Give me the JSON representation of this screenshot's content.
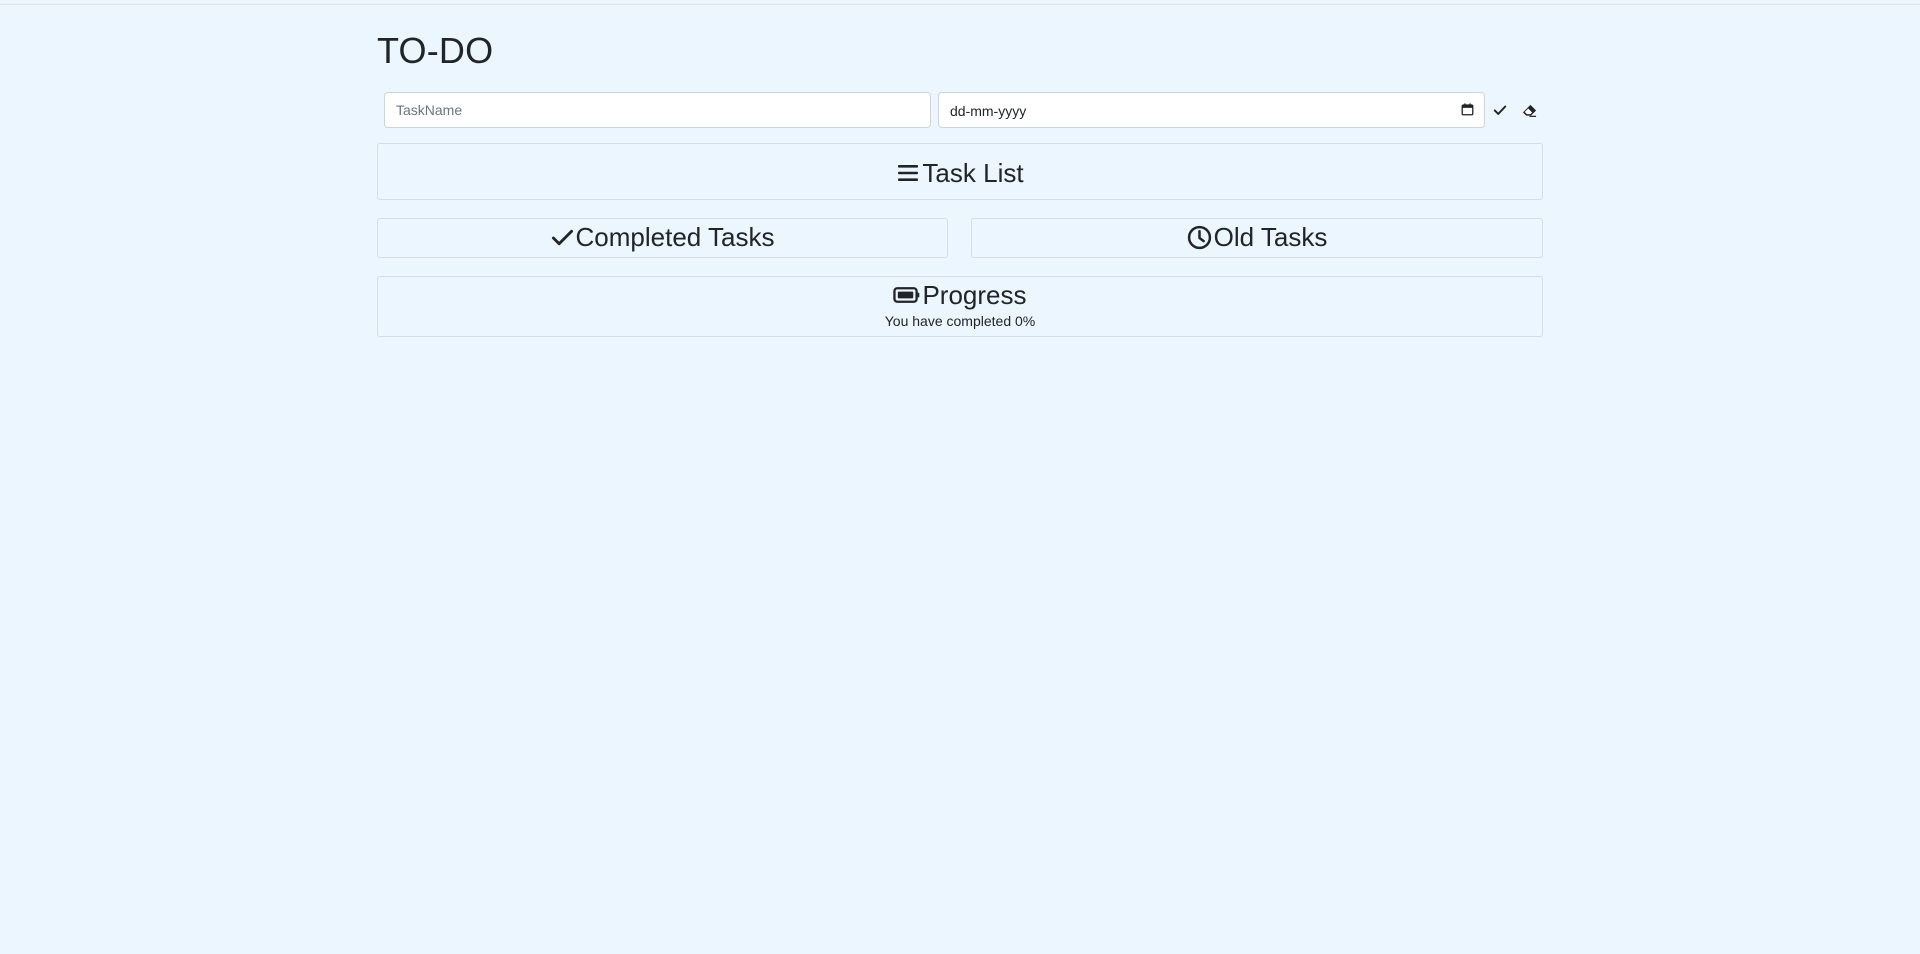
{
  "app": {
    "title": "TO-DO"
  },
  "form": {
    "task_name_placeholder": "TaskName",
    "task_name_value": "",
    "date_placeholder": "dd-mm-yyyy",
    "add_icon": "check-icon",
    "clear_icon": "eraser-icon"
  },
  "sections": {
    "task_list": {
      "label": "Task List",
      "icon": "list-icon"
    },
    "completed": {
      "label": "Completed Tasks",
      "icon": "check-icon"
    },
    "old": {
      "label": "Old Tasks",
      "icon": "clock-icon"
    },
    "progress": {
      "label": "Progress",
      "icon": "battery-icon",
      "status_text": "You have completed 0%",
      "percent_complete": 0
    }
  },
  "colors": {
    "background": "#ecf6fe",
    "text": "#212529",
    "border": "#d7dde1"
  }
}
